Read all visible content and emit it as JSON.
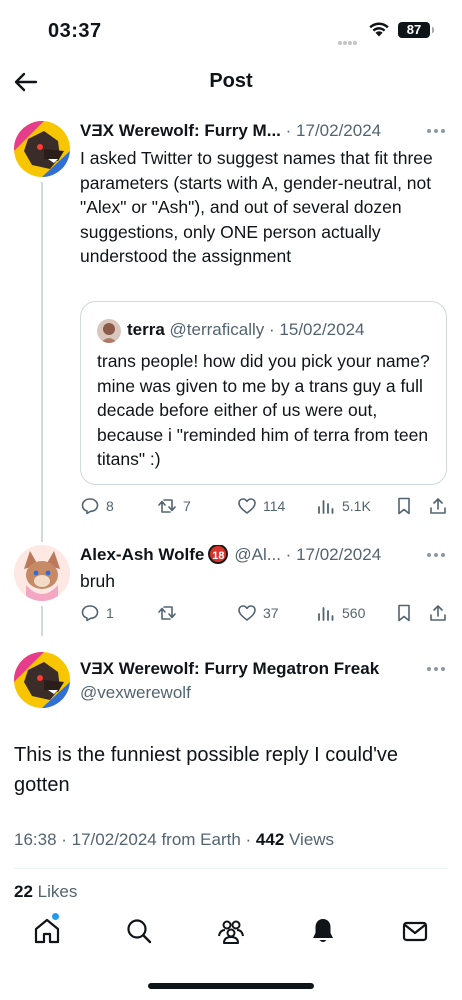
{
  "status_bar": {
    "time": "03:37",
    "battery": "87"
  },
  "header": {
    "title": "Post"
  },
  "tweets": [
    {
      "name": "VƎX Werewolf: Furry M...",
      "separator": "·",
      "date": "17/02/2024",
      "text": "I asked Twitter to suggest names that fit three parameters (starts with A, gender-neutral, not \"Alex\" or \"Ash\"), and out of several dozen suggestions, only ONE person actually understood the assignment",
      "quote": {
        "name": "terra",
        "handle": "@terrafically",
        "separator": "·",
        "date": "15/02/2024",
        "text": "trans people! how did you pick your name? mine was given to me by a trans guy a full decade before either of us were out, because i \"reminded him of terra from teen titans\" :)"
      },
      "stats": {
        "replies": "8",
        "retweets": "7",
        "likes": "114",
        "views": "5.1K"
      }
    },
    {
      "name": "Alex-Ash Wolfe",
      "badge": "18",
      "handle": "@Al...",
      "separator": "·",
      "date": "17/02/2024",
      "text": "bruh",
      "stats": {
        "replies": "1",
        "retweets": "",
        "likes": "37",
        "views": "560"
      }
    }
  ],
  "main_tweet": {
    "name": "VƎX Werewolf: Furry Megatron Freak",
    "handle": "@vexwerewolf",
    "text": "This is the funniest possible reply I could've gotten",
    "timestamp": "16:38 · 17/02/2024 from Earth · ",
    "views_count": "442",
    "views_label": " Views",
    "likes_count": "22",
    "likes_label": " Likes"
  },
  "nav": [
    "home-icon",
    "search-icon",
    "communities-icon",
    "notifications-icon",
    "messages-icon"
  ],
  "colors": {
    "accent": "#1d9bf0",
    "muted": "#536471",
    "border": "#cfd9de"
  }
}
